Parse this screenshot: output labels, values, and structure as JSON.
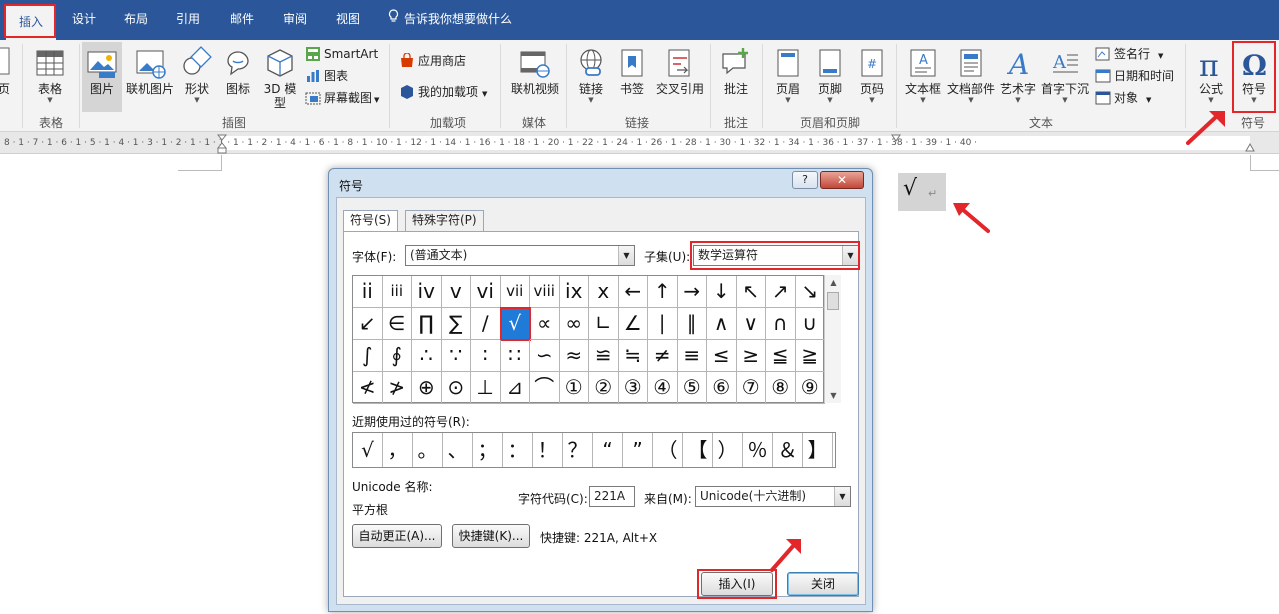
{
  "ribbon": {
    "tabs": [
      {
        "label": "插入",
        "active": true
      },
      {
        "label": "设计"
      },
      {
        "label": "布局"
      },
      {
        "label": "引用"
      },
      {
        "label": "邮件"
      },
      {
        "label": "审阅"
      },
      {
        "label": "视图"
      }
    ],
    "tell_me": "告诉我你想要做什么",
    "groups": {
      "pages": {
        "btn": "页"
      },
      "table": {
        "btn": "表格",
        "label": "表格"
      },
      "illustrations": {
        "label": "插图",
        "picture": "图片",
        "online_picture": "联机图片",
        "shapes": "形状",
        "icons": "图标",
        "model_3d_1": "3D 模",
        "model_3d_2": "型",
        "smartart": "SmartArt",
        "chart": "图表",
        "screenshot": "屏幕截图"
      },
      "addins": {
        "label": "加载项",
        "store": "应用商店",
        "my_addins": "我的加载项"
      },
      "media": {
        "label": "媒体",
        "online_video": "联机视频"
      },
      "links": {
        "label": "链接",
        "link": "链接",
        "bookmark": "书签",
        "cross_ref": "交叉引用"
      },
      "comments": {
        "label": "批注",
        "comment": "批注"
      },
      "header_footer": {
        "label": "页眉和页脚",
        "header": "页眉",
        "footer": "页脚",
        "page_number": "页码"
      },
      "text": {
        "label": "文本",
        "textbox": "文本框",
        "quick_parts": "文档部件",
        "wordart": "艺术字",
        "drop_cap": "首字下沉",
        "signature": "签名行",
        "datetime": "日期和时间",
        "object": "对象"
      },
      "symbols": {
        "label": "符号",
        "equation": "公式",
        "symbol": "符号"
      }
    }
  },
  "ruler": {
    "left": "8 · 1 · 7 · 1 · 6 · 1 · 5 · 1 · 4 · 1 · 3 · 1 · 2 · 1 · 1 · 1 · 1 · 1 · 2 · 1 · 4 · 1 · 6 · 1 · 8 · 1 · 10 · 1 · 12 · 1 · 14 · 1 · 16 · 1 · 18 · 1 · 20 · 1 · 22 · 1 · 24 · 1 · 26 · 1 · 28 · 1 · 30 · 1 · 32 · 1 · 34 · 1 · 36 · 1 · 37 · 1 · 38 · 1 · 39 · 1 · 40 ·"
  },
  "document": {
    "inserted_symbol": "√",
    "para_mark": "↵"
  },
  "dialog": {
    "title": "符号",
    "help": "?",
    "close": "✕",
    "tabs": [
      "符号(S)",
      "特殊字符(P)"
    ],
    "font_label": "字体(F):",
    "font_value": "(普通文本)",
    "subset_label": "子集(U):",
    "subset_value": "数学运算符",
    "symbols_grid": [
      [
        "ii",
        "iii",
        "iv",
        "v",
        "vi",
        "vii",
        "viii",
        "ix",
        "x",
        "←",
        "↑",
        "→",
        "↓",
        "↖",
        "↗",
        "↘"
      ],
      [
        "↙",
        "∈",
        "∏",
        "∑",
        "∕",
        "√",
        "∝",
        "∞",
        "∟",
        "∠",
        "∣",
        "∥",
        "∧",
        "∨",
        "∩",
        "∪"
      ],
      [
        "∫",
        "∮",
        "∴",
        "∵",
        "∶",
        "∷",
        "∽",
        "≈",
        "≌",
        "≒",
        "≠",
        "≡",
        "≤",
        "≥",
        "≦",
        "≧"
      ],
      [
        "≮",
        "≯",
        "⊕",
        "⊙",
        "⊥",
        "⊿",
        "⌒",
        "①",
        "②",
        "③",
        "④",
        "⑤",
        "⑥",
        "⑦",
        "⑧",
        "⑨"
      ]
    ],
    "selected_symbol": "√",
    "recent_label": "近期使用过的符号(R):",
    "recent": [
      "√",
      "，",
      "。",
      "、",
      "；",
      "：",
      "！",
      "？",
      "“",
      "”",
      "（",
      "【",
      "）",
      "％",
      "＆",
      "】"
    ],
    "unicode_name_label": "Unicode 名称:",
    "unicode_name": "平方根",
    "char_code_label": "字符代码(C):",
    "char_code": "221A",
    "from_label": "来自(M):",
    "from_value": "Unicode(十六进制)",
    "autocorrect_btn": "自动更正(A)...",
    "shortcut_btn": "快捷键(K)...",
    "shortcut_text": "快捷键: 221A, Alt+X",
    "insert_btn": "插入(I)",
    "close_btn": "关闭"
  },
  "colors": {
    "ribbon_blue": "#2b579a",
    "highlight_red": "#e2262a",
    "selected_cell": "#1f7ad8"
  }
}
